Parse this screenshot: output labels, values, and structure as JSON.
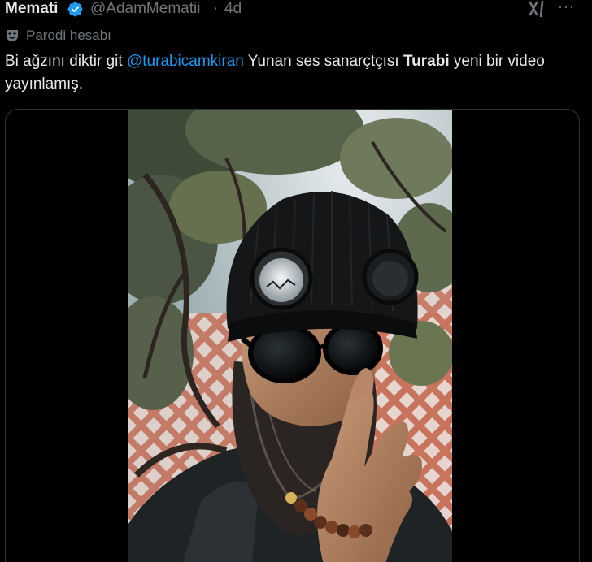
{
  "author": {
    "display_name": "Memati",
    "handle": "@AdamMematii",
    "separator": "·",
    "time": "4d",
    "verified_icon": "verified-badge-icon",
    "verified_color": "#1d9bf0"
  },
  "parody": {
    "icon": "theater-mask-icon",
    "label": "Parodi hesabı"
  },
  "tweet": {
    "text_part1": "Bi ağzını diktir git ",
    "mention": "@turabicamkiran",
    "text_part2": " Yunan ses sanarçtçısı ",
    "bold_name": "Turabi",
    "text_part3": " yeni bir video yayınlamış."
  },
  "actions": {
    "grok_icon": "grok-icon",
    "more_icon": "more-options-icon",
    "more_glyph": "···"
  },
  "media": {
    "type": "video",
    "subject": "man-in-black-beanie-and-sunglasses"
  },
  "colors": {
    "background": "#000000",
    "text": "#e7e9ea",
    "secondary": "#71767b",
    "link": "#1d9bf0",
    "border": "#2f3336"
  }
}
